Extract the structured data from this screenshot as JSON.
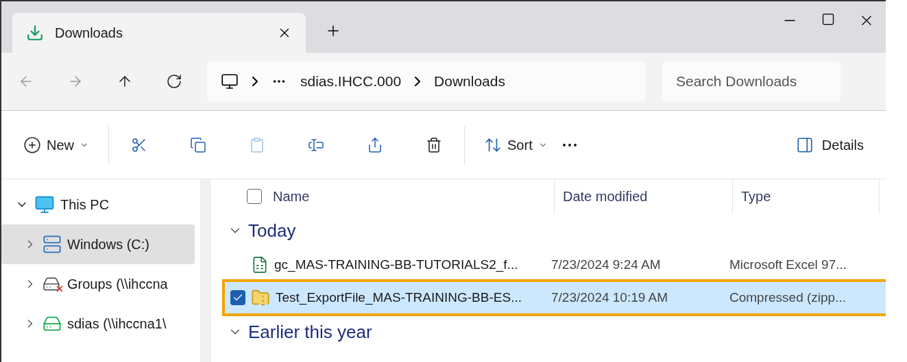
{
  "tab": {
    "label": "Downloads",
    "selected": true
  },
  "address": {
    "path": [
      "sdias.IHCC.000",
      "Downloads"
    ]
  },
  "search": {
    "placeholder": "Search Downloads"
  },
  "toolbar": {
    "new": "New",
    "sort": "Sort",
    "details": "Details"
  },
  "sidebar": {
    "items": [
      {
        "label": "This PC",
        "kind": "pc",
        "expanded": true,
        "selected": false,
        "children": [
          {
            "label": "Windows (C:)",
            "kind": "drive",
            "expanded": false,
            "selected": true
          },
          {
            "label": "Groups (\\\\ihccna",
            "kind": "netdrive-off",
            "expanded": false,
            "selected": false
          },
          {
            "label": "sdias (\\\\ihccna1\\",
            "kind": "netdrive",
            "expanded": false,
            "selected": false
          }
        ]
      }
    ]
  },
  "table": {
    "select_all": {
      "checked": false
    },
    "columns": [
      "Name",
      "Date modified",
      "Type"
    ],
    "groups": [
      {
        "label": "Today",
        "expanded": true,
        "rows": [
          {
            "name": "gc_MAS-TRAINING-BB-TUTORIALS2_f...",
            "kind": "excel",
            "date": "7/23/2024 9:24 AM",
            "type": "Microsoft Excel 97...",
            "selected": false,
            "checked": false,
            "highlighted": false
          },
          {
            "name": "Test_ExportFile_MAS-TRAINING-BB-ES...",
            "kind": "zip",
            "date": "7/23/2024 10:19 AM",
            "type": "Compressed (zipp...",
            "selected": true,
            "checked": true,
            "highlighted": true
          }
        ]
      },
      {
        "label": "Earlier this year",
        "expanded": true
      }
    ]
  }
}
